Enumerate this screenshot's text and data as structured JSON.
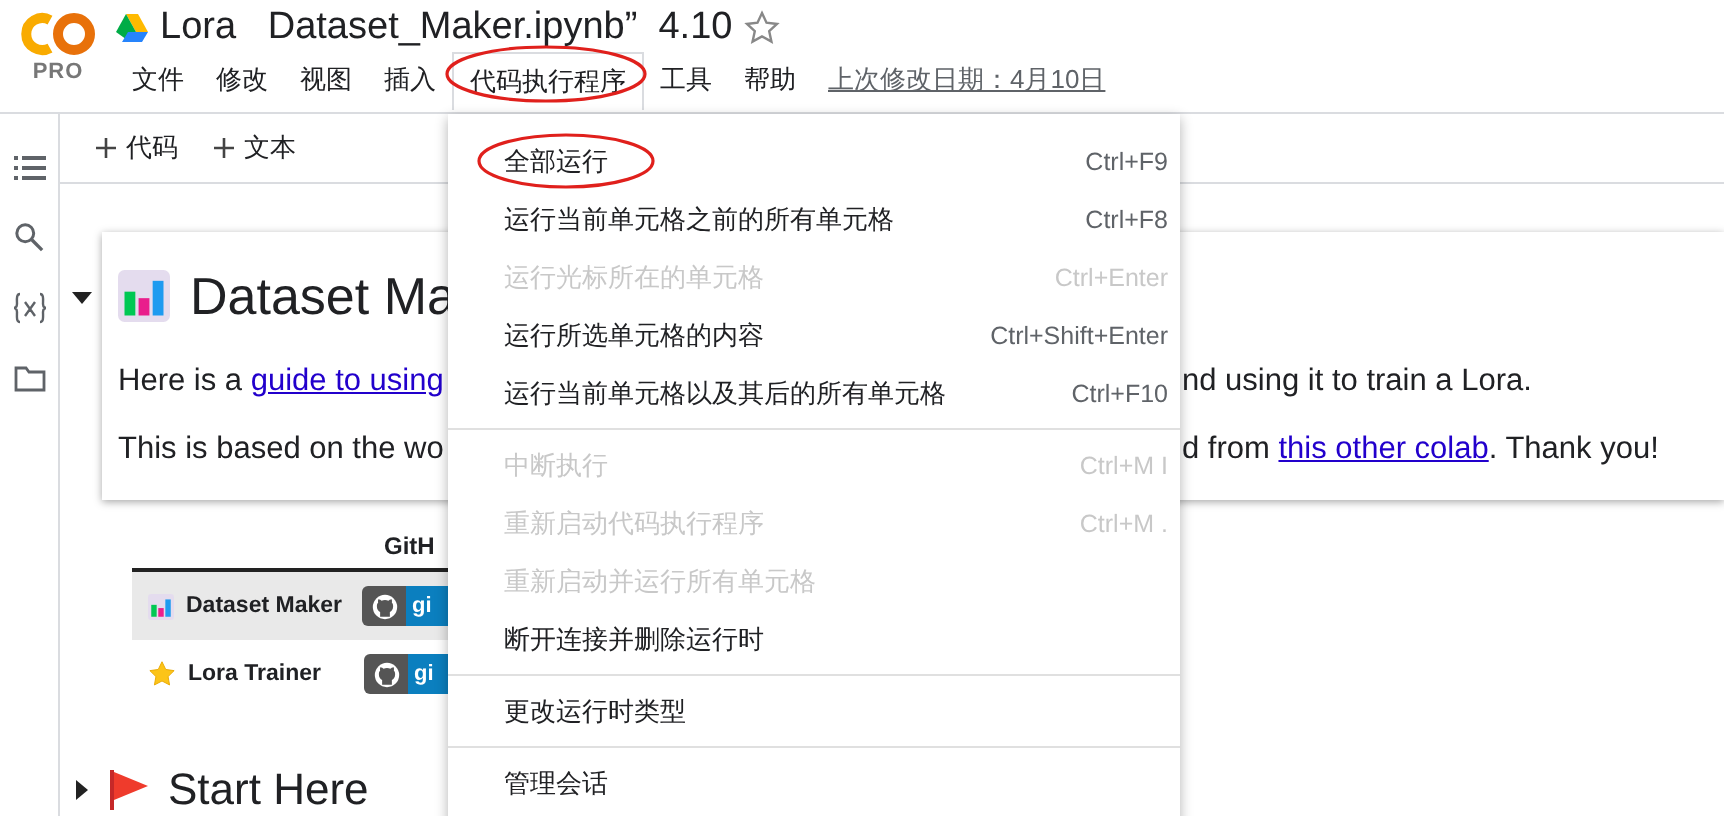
{
  "header": {
    "product_badge": "PRO",
    "notebook_title": "Lora   Dataset_Maker.ipynb”  4.10",
    "starred": false
  },
  "menu_bar": {
    "items": [
      {
        "label": "文件",
        "selected": false,
        "circled": false
      },
      {
        "label": "修改",
        "selected": false,
        "circled": false
      },
      {
        "label": "视图",
        "selected": false,
        "circled": false
      },
      {
        "label": "插入",
        "selected": false,
        "circled": false
      },
      {
        "label": "代码执行程序",
        "selected": true,
        "circled": true
      },
      {
        "label": "工具",
        "selected": false,
        "circled": false
      },
      {
        "label": "帮助",
        "selected": false,
        "circled": false
      }
    ],
    "last_modified": "上次修改日期：4月10日"
  },
  "toolbar": {
    "buttons": [
      "代码",
      "文本"
    ]
  },
  "cells": [
    {
      "kind": "intro",
      "expanded": true,
      "title": "Dataset Ma",
      "paragraphs": [
        {
          "left": [
            {
              "text": "Here is a ",
              "kind": "text"
            },
            {
              "text": "guide to using",
              "kind": "link"
            }
          ],
          "right": [
            {
              "text": "nd using it to train a Lora.",
              "kind": "text"
            }
          ]
        },
        {
          "left": [
            {
              "text": "This is based on the wo",
              "kind": "text"
            }
          ],
          "right": [
            {
              "text": "d from ",
              "kind": "text"
            },
            {
              "text": "this other colab",
              "kind": "link"
            },
            {
              "text": ". Thank you!",
              "kind": "text"
            }
          ]
        }
      ],
      "table": {
        "header": "GitH",
        "rows": [
          {
            "kind": "chart",
            "name": "Dataset Maker",
            "badge": "gi",
            "highlighted": true
          },
          {
            "kind": "star",
            "name": "Lora Trainer",
            "badge": "gi",
            "highlighted": false
          }
        ]
      }
    },
    {
      "kind": "section",
      "expanded": false,
      "title": "Start Here"
    }
  ],
  "dropdown": {
    "groups": [
      [
        {
          "label": "全部运行",
          "shortcut": "Ctrl+F9",
          "disabled": false,
          "circled": true
        },
        {
          "label": "运行当前单元格之前的所有单元格",
          "shortcut": "Ctrl+F8",
          "disabled": false,
          "circled": false
        },
        {
          "label": "运行光标所在的单元格",
          "shortcut": "Ctrl+Enter",
          "disabled": true,
          "circled": false
        },
        {
          "label": "运行所选单元格的内容",
          "shortcut": "Ctrl+Shift+Enter",
          "disabled": false,
          "circled": false
        },
        {
          "label": "运行当前单元格以及其后的所有单元格",
          "shortcut": "Ctrl+F10",
          "disabled": false,
          "circled": false
        }
      ],
      [
        {
          "label": "中断执行",
          "shortcut": "Ctrl+M I",
          "disabled": true,
          "circled": false
        },
        {
          "label": "重新启动代码执行程序",
          "shortcut": "Ctrl+M .",
          "disabled": true,
          "circled": false
        },
        {
          "label": "重新启动并运行所有单元格",
          "disabled": true,
          "circled": false
        },
        {
          "label": "断开连接并删除运行时",
          "disabled": false,
          "circled": false
        }
      ],
      [
        {
          "label": "更改运行时类型",
          "disabled": false,
          "circled": false
        }
      ],
      [
        {
          "label": "管理会话",
          "disabled": false,
          "circled": false
        }
      ]
    ]
  }
}
